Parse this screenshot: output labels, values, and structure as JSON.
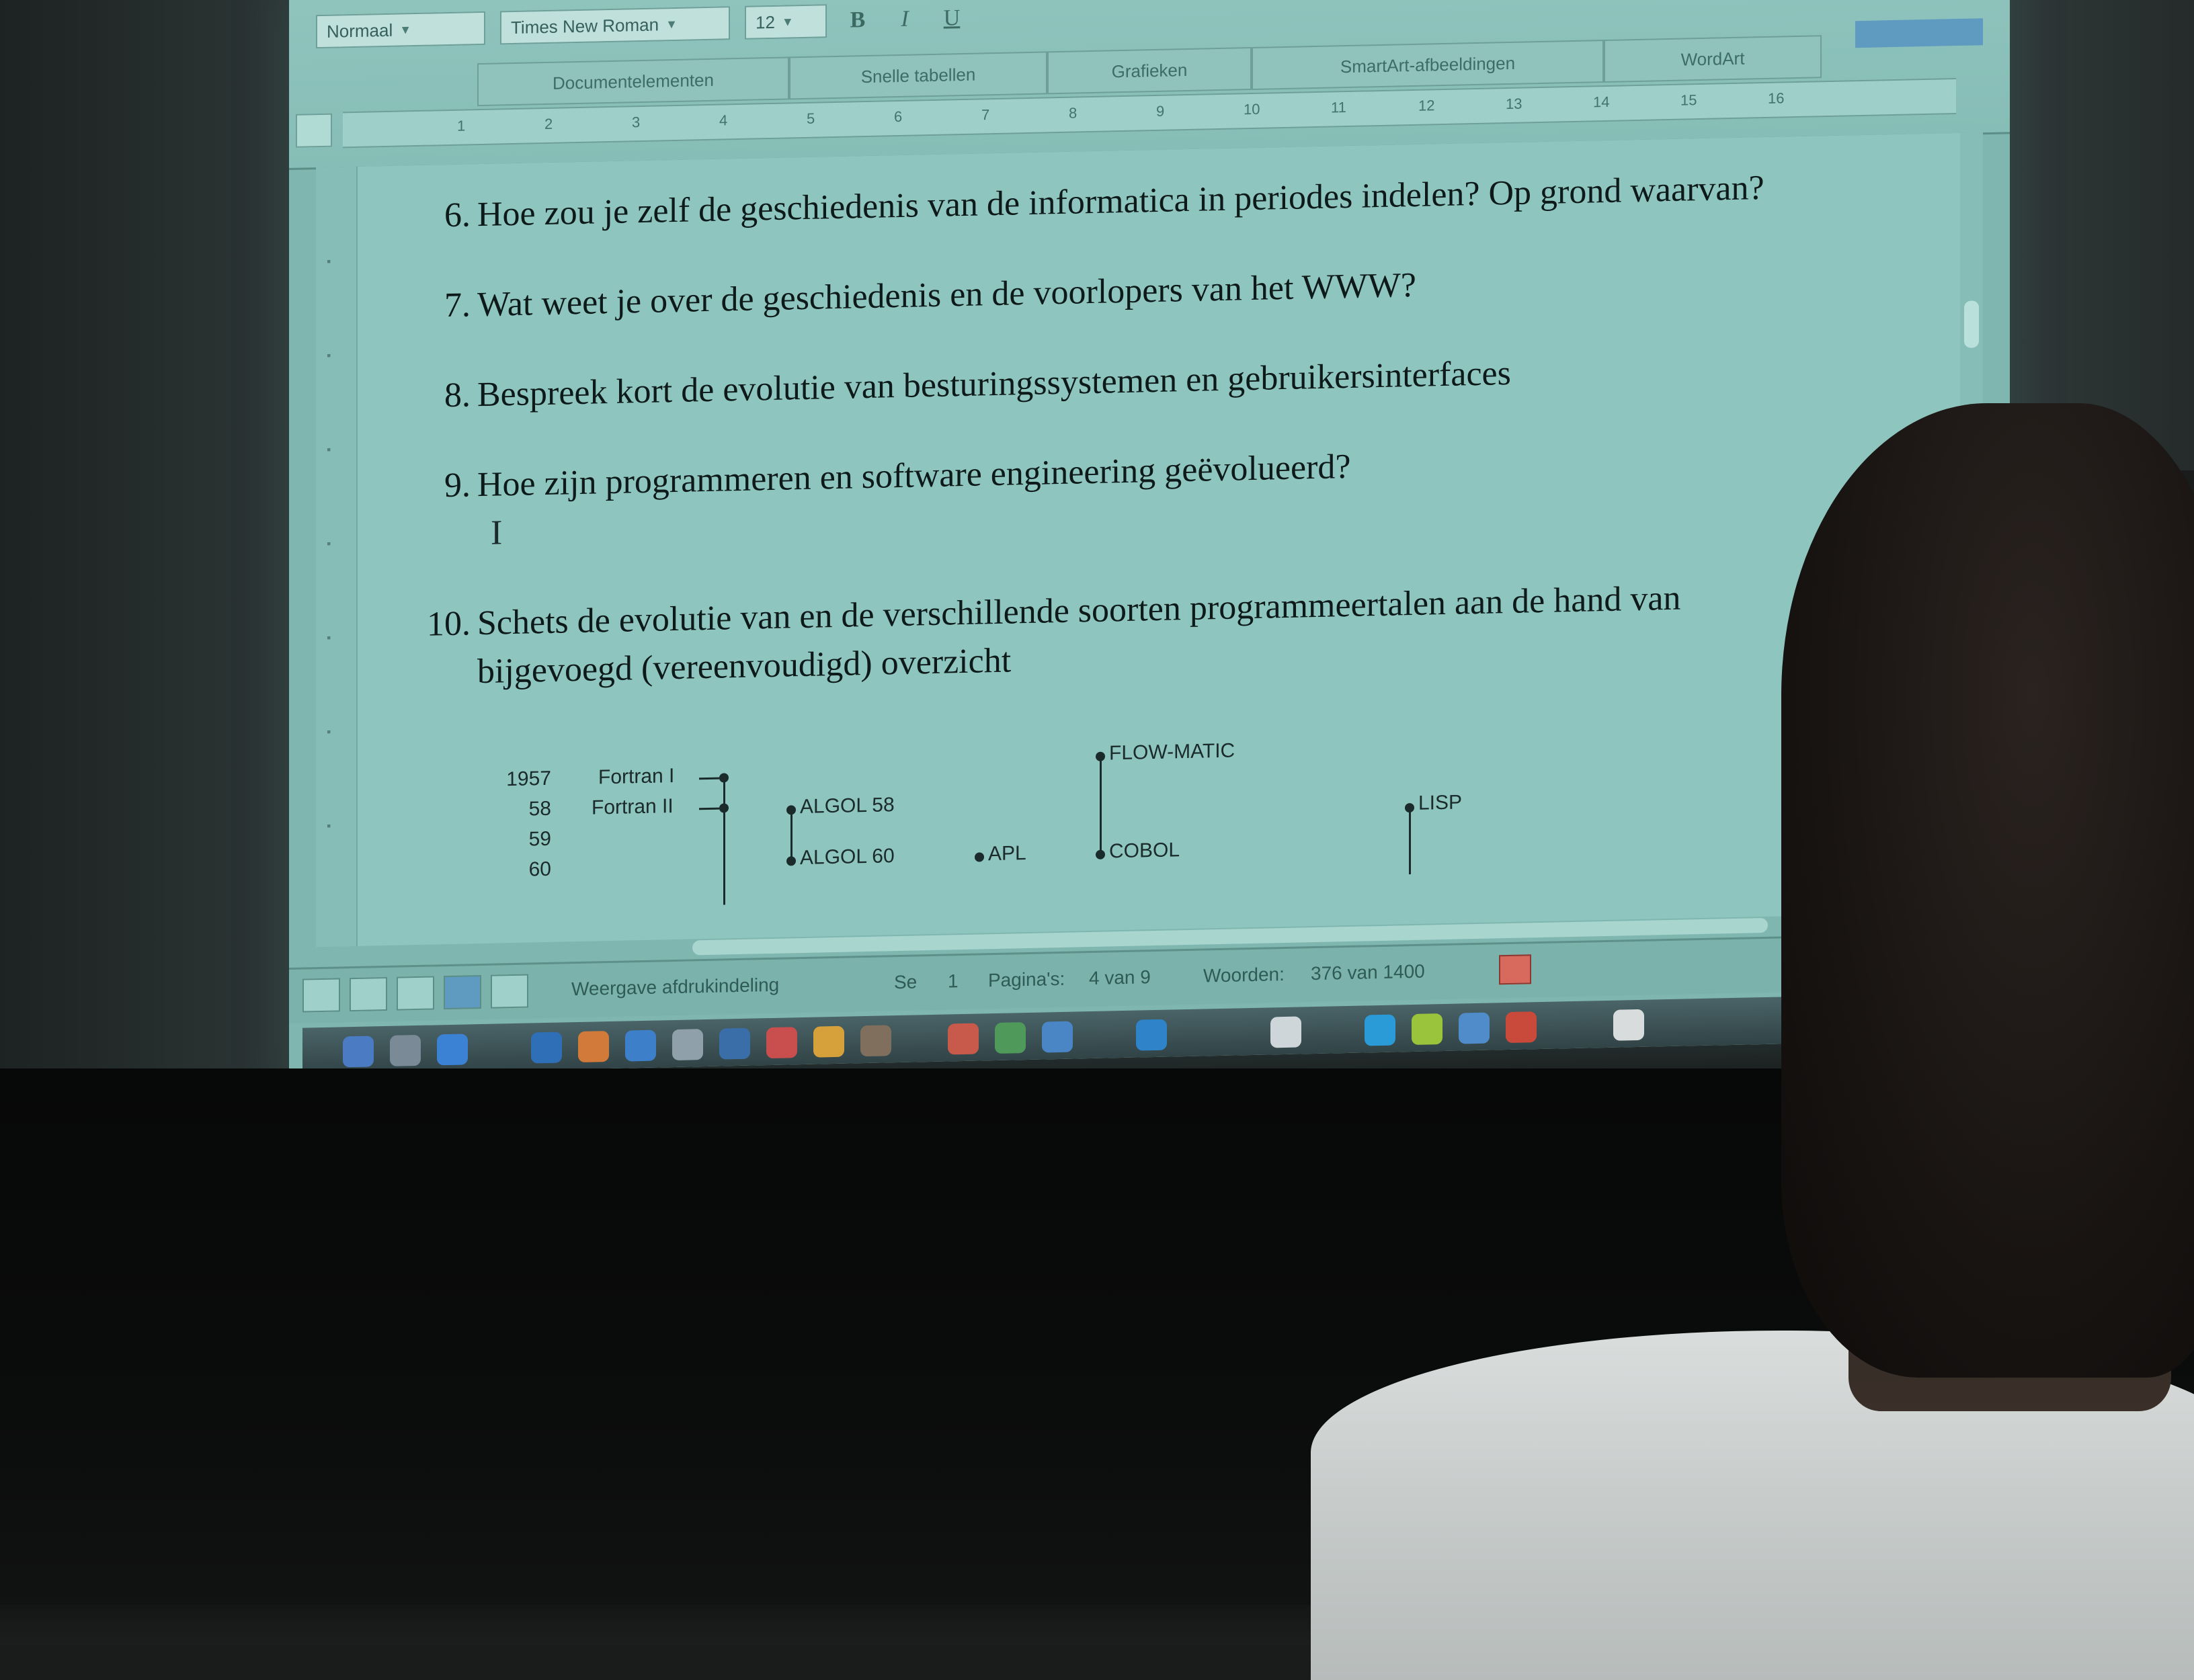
{
  "toolbar": {
    "style_value": "Normaal",
    "font_value": "Times New Roman",
    "size_value": "12",
    "bold_label": "B",
    "italic_label": "I",
    "underline_label": "U",
    "ribbon_tabs": [
      "Documentelementen",
      "Snelle tabellen",
      "Grafieken",
      "SmartArt-afbeeldingen",
      "WordArt"
    ],
    "zoom": "",
    "ruler_ticks": [
      "1",
      "2",
      "3",
      "4",
      "5",
      "6",
      "7",
      "8",
      "9",
      "10",
      "11",
      "12",
      "13",
      "14",
      "15",
      "16"
    ]
  },
  "document": {
    "questions": [
      {
        "num": "6.",
        "text": "Hoe zou je zelf de geschiedenis van de informatica in periodes indelen? Op grond waarvan?"
      },
      {
        "num": "7.",
        "text": "Wat weet je over de geschiedenis en de voorlopers van het WWW?"
      },
      {
        "num": "8.",
        "text": "Bespreek kort de evolutie van besturingssystemen en gebruikersinterfaces"
      },
      {
        "num": "9.",
        "text": "Hoe zijn programmeren en software engineering geëvolueerd?"
      },
      {
        "num": "10.",
        "text": "Schets de evolutie van en de verschillende soorten programmeertalen aan de hand van bijgevoegd (vereenvoudigd) overzicht"
      }
    ],
    "timeline": {
      "years": [
        "1957",
        "58",
        "59",
        "60"
      ],
      "languages": [
        "Fortran I",
        "Fortran II",
        "ALGOL 58",
        "ALGOL 60",
        "APL",
        "FLOW-MATIC",
        "COBOL",
        "LISP"
      ]
    }
  },
  "statusbar": {
    "view_label": "Weergave afdrukindeling",
    "section_label": "Se",
    "section_value": "1",
    "pages_label": "Pagina's:",
    "pages_value": "4 van 9",
    "words_label": "Woorden:",
    "words_value": "376 van 1400"
  },
  "colors": {
    "screen": "#7fb7b0",
    "text": "#0e1a1a",
    "accent": "#5f9ac0"
  }
}
